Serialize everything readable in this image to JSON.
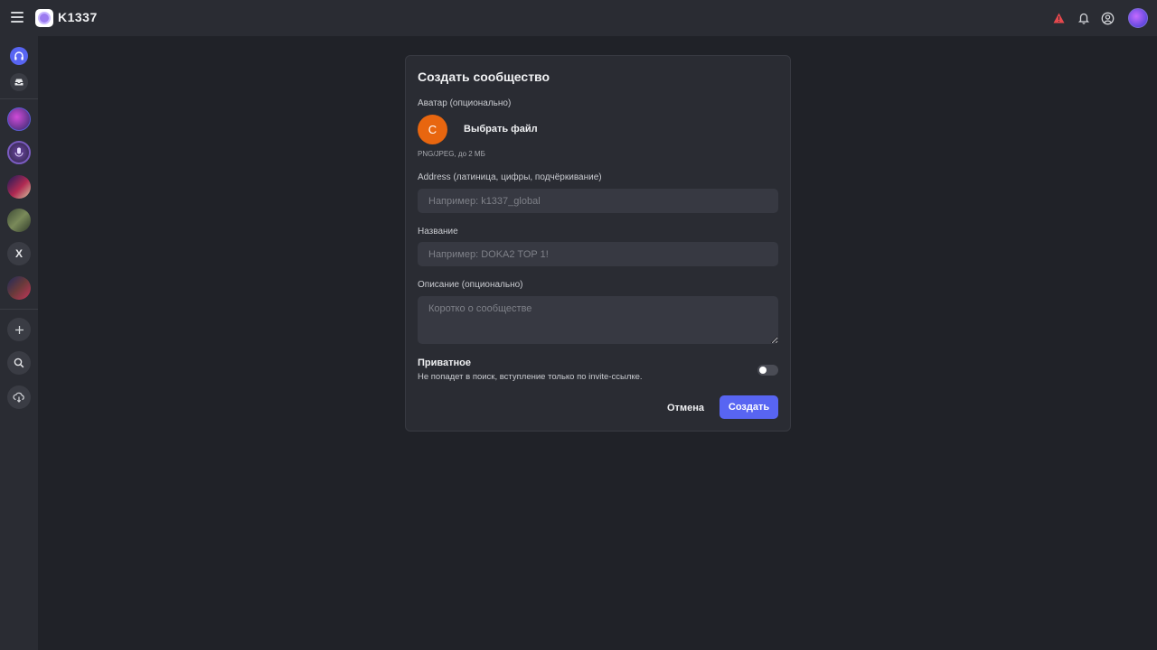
{
  "app": {
    "title": "K1337"
  },
  "topbar": {
    "icons": [
      "menu-icon",
      "warning-icon",
      "bell-icon",
      "user-circle-icon",
      "user-avatar"
    ],
    "warning_color": "#e5484d"
  },
  "sidebar": {
    "top_items": [
      "headphones-icon",
      "inbox-icon"
    ],
    "servers": [
      {
        "type": "image",
        "name": "server-avatar-1"
      },
      {
        "type": "image",
        "name": "server-avatar-2"
      },
      {
        "type": "image",
        "name": "server-avatar-3"
      },
      {
        "type": "image",
        "name": "server-avatar-4"
      },
      {
        "type": "letter",
        "label": "X"
      },
      {
        "type": "image",
        "name": "server-avatar-6"
      }
    ],
    "actions": [
      "plus-icon",
      "search-icon",
      "cloud-download-icon"
    ]
  },
  "modal": {
    "title": "Создать сообщество",
    "avatar": {
      "label": "Аватар (опционально)",
      "initial": "С",
      "color": "#e8660f",
      "choose_file": "Выбрать файл",
      "hint": "PNG/JPEG, до 2 МБ"
    },
    "address": {
      "label": "Address (латиница, цифры, подчёркивание)",
      "value": "",
      "placeholder": "Например: k1337_global"
    },
    "name": {
      "label": "Название",
      "value": "",
      "placeholder": "Например: DOKA2 TOP 1!"
    },
    "description": {
      "label": "Описание (опционально)",
      "value": "",
      "placeholder": "Коротко о сообществе"
    },
    "private": {
      "title": "Приватное",
      "description": "Не попадет в поиск, вступление только по invite-ссылке.",
      "enabled": false
    },
    "buttons": {
      "cancel": "Отмена",
      "create": "Создать"
    },
    "accent": "#5865f2"
  }
}
